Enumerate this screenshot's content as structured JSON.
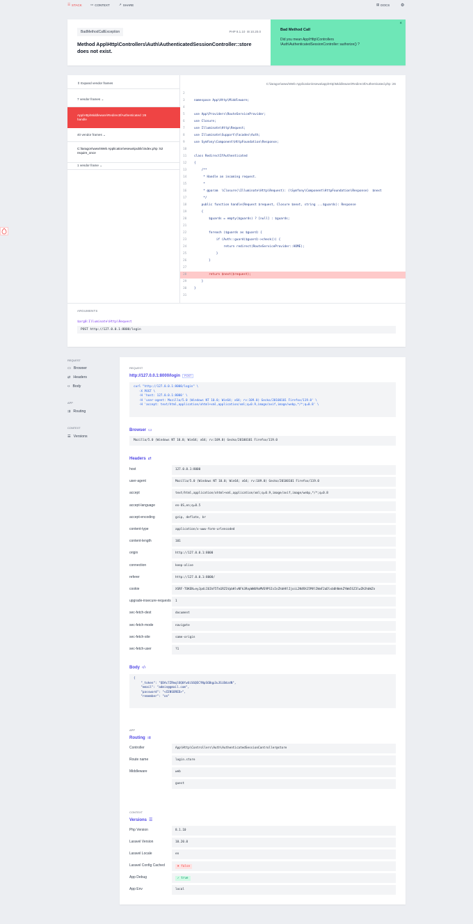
{
  "nav": {
    "stack": "Stack",
    "context": "Context",
    "share": "Share",
    "docs": "Docs"
  },
  "exception": {
    "class": "BadMethodCallException",
    "php_version": "PHP 8.1.10",
    "laravel_version": "10.20.0",
    "message": "Method App\\Http\\Controllers\\Auth\\AuthenticatedSessionController::store does not exist."
  },
  "solution": {
    "title": "Bad Method Call",
    "text": "Did you mean App\\Http\\Controllers \\Auth\\AuthenticatedSessionController::authorize() ?"
  },
  "stack": {
    "expand_label": "Expand vendor frames",
    "frames": [
      {
        "text": "7 vendor frames"
      },
      {
        "text": "App\\Http\\Middleware\\RedirectIfAuthenticated :26",
        "sub": "handle"
      },
      {
        "text": "40 vendor frames"
      },
      {
        "text": "C:\\laragon\\www\\Web Application\\esewa\\public\\index.php :52",
        "sub": "require_once"
      },
      {
        "text": "1 vendor frame"
      }
    ],
    "file_path": "C:\\laragon\\www\\Web Application\\esewa\\app\\Http\\Middleware\\RedirectIfAuthenticated.php :26",
    "code": [
      {
        "n": "2",
        "t": ""
      },
      {
        "n": "3",
        "t": "namespace App\\Http\\Middleware;"
      },
      {
        "n": "4",
        "t": ""
      },
      {
        "n": "5",
        "t": "use App\\Providers\\RouteServiceProvider;"
      },
      {
        "n": "6",
        "t": "use Closure;"
      },
      {
        "n": "7",
        "t": "use Illuminate\\Http\\Request;"
      },
      {
        "n": "8",
        "t": "use Illuminate\\Support\\Facades\\Auth;"
      },
      {
        "n": "9",
        "t": "use Symfony\\Component\\HttpFoundation\\Response;"
      },
      {
        "n": "10",
        "t": ""
      },
      {
        "n": "11",
        "t": "class RedirectIfAuthenticated"
      },
      {
        "n": "12",
        "t": "{"
      },
      {
        "n": "13",
        "t": "    /**"
      },
      {
        "n": "14",
        "t": "     * Handle an incoming request."
      },
      {
        "n": "15",
        "t": "     *"
      },
      {
        "n": "16",
        "t": "     * @param  \\Closure(\\Illuminate\\Http\\Request): (\\Symfony\\Component\\HttpFoundation\\Response)  $next"
      },
      {
        "n": "17",
        "t": "     */"
      },
      {
        "n": "18",
        "t": "    public function handle(Request $request, Closure $next, string ...$guards): Response"
      },
      {
        "n": "19",
        "t": "    {"
      },
      {
        "n": "20",
        "t": "        $guards = empty($guards) ? [null] : $guards;"
      },
      {
        "n": "21",
        "t": ""
      },
      {
        "n": "22",
        "t": "        foreach ($guards as $guard) {"
      },
      {
        "n": "23",
        "t": "            if (Auth::guard($guard)->check()) {"
      },
      {
        "n": "24",
        "t": "                return redirect(RouteServiceProvider::HOME);"
      },
      {
        "n": "25",
        "t": "            }"
      },
      {
        "n": "26",
        "t": "        }"
      },
      {
        "n": "27",
        "t": ""
      },
      {
        "n": "28",
        "t": "        return $next($request);"
      },
      {
        "n": "29",
        "t": "    }"
      },
      {
        "n": "30",
        "t": "}"
      },
      {
        "n": "31",
        "t": ""
      }
    ],
    "highlight_line": "28",
    "arguments_title": "Arguments",
    "arg_var": "$arg0:Illuminate\\Http\\Request",
    "arg_value": "POST http://127.0.0.1:8000/login"
  },
  "sidebar": {
    "request_group": "Request",
    "browser": "Browser",
    "headers": "Headers",
    "body": "Body",
    "app_group": "App",
    "routing": "Routing",
    "context_group": "Context",
    "versions": "Versions"
  },
  "request": {
    "label": "Request",
    "url": "http://127.0.0.1:8000/login",
    "method": "POST",
    "curl": "curl \"http://127.0.0.1:8000/login\" \\\n   -X POST \\\n   -H 'host: 127.0.0.1:8000' \\\n   -H 'user-agent: Mozilla/5.0 (Windows NT 10.0; Win64; x64; rv:109.0) Gecko/20100101 Firefox/119.0' \\\n   -H 'accept: text/html,application/xhtml+xml,application/xml;q=0.9,image/avif,image/webp,*/*;q=0.8' \\"
  },
  "browser": {
    "title": "Browser",
    "value": "Mozilla/5.0 (Windows NT 10.0; Win64; x64; rv:109.0) Gecko/20100101 Firefox/119.0"
  },
  "headers": {
    "title": "Headers",
    "rows": [
      {
        "k": "host",
        "v": "127.0.0.1:8000"
      },
      {
        "k": "user-agent",
        "v": "Mozilla/5.0 (Windows NT 10.0; Win64; x64; rv:109.0) Gecko/20100101 Firefox/119.0"
      },
      {
        "k": "accept",
        "v": "text/html,application/xhtml+xml,application/xml;q=0.9,image/avif,image/webp,*/*;q=0.8"
      },
      {
        "k": "accept-language",
        "v": "en-US,en;q=0.5"
      },
      {
        "k": "accept-encoding",
        "v": "gzip, deflate, br"
      },
      {
        "k": "content-type",
        "v": "application/x-www-form-urlencoded"
      },
      {
        "k": "content-length",
        "v": "101"
      },
      {
        "k": "origin",
        "v": "http://127.0.0.1:8000"
      },
      {
        "k": "connection",
        "v": "keep-alive"
      },
      {
        "k": "referer",
        "v": "http://127.0.0.1:8000/"
      },
      {
        "k": "cookie",
        "v": "XSRF-TOKEN=eyJpdiI6IkF5Tm1RZ1VpbHlvNFk3RnpWWU9aMVE9PSIsInZhbHVlIjoiL2N4RXJ5MVlIWmF2aDlxb0hNekZYWm5SZ3lwZHJhbWZn"
      },
      {
        "k": "upgrade-insecure-requests",
        "v": "1"
      },
      {
        "k": "sec-fetch-dest",
        "v": "document"
      },
      {
        "k": "sec-fetch-mode",
        "v": "navigate"
      },
      {
        "k": "sec-fetch-site",
        "v": "same-origin"
      },
      {
        "k": "sec-fetch-user",
        "v": "?1"
      }
    ]
  },
  "body_section": {
    "title": "Body",
    "json": "{\n    \"_token\": \"QDAc7ZRmqlOQ0fwUiS6QECYNpS6Bqp3uJGiBdzdN\",\n    \"email\": \"admin@gmail.com\",\n    \"password\": \"<CENSORED>\",\n    \"remember\": \"on\""
  },
  "app": {
    "label": "App",
    "routing_title": "Routing",
    "rows": [
      {
        "k": "Controller",
        "v": "App\\Http\\Controllers\\Auth\\AuthenticatedSessionController@store"
      },
      {
        "k": "Route name",
        "v": "login.store"
      },
      {
        "k": "Middleware",
        "v": "web"
      },
      {
        "k": "",
        "v": "guest"
      }
    ]
  },
  "context": {
    "label": "Context",
    "versions_title": "Versions",
    "rows": [
      {
        "k": "Php Version",
        "v": "8.1.10"
      },
      {
        "k": "Laravel Version",
        "v": "10.20.0"
      },
      {
        "k": "Laravel Locale",
        "v": "en"
      },
      {
        "k": "Laravel Config Cached",
        "v": "✖ false",
        "kind": "false"
      },
      {
        "k": "App Debug",
        "v": "✓ true",
        "kind": "true"
      },
      {
        "k": "App Env",
        "v": "local"
      }
    ]
  },
  "colors": {
    "accent": "#4f46e5",
    "error": "#ef4444",
    "solution_bg": "#6ee7b7",
    "page_bg": "#eceef2"
  }
}
